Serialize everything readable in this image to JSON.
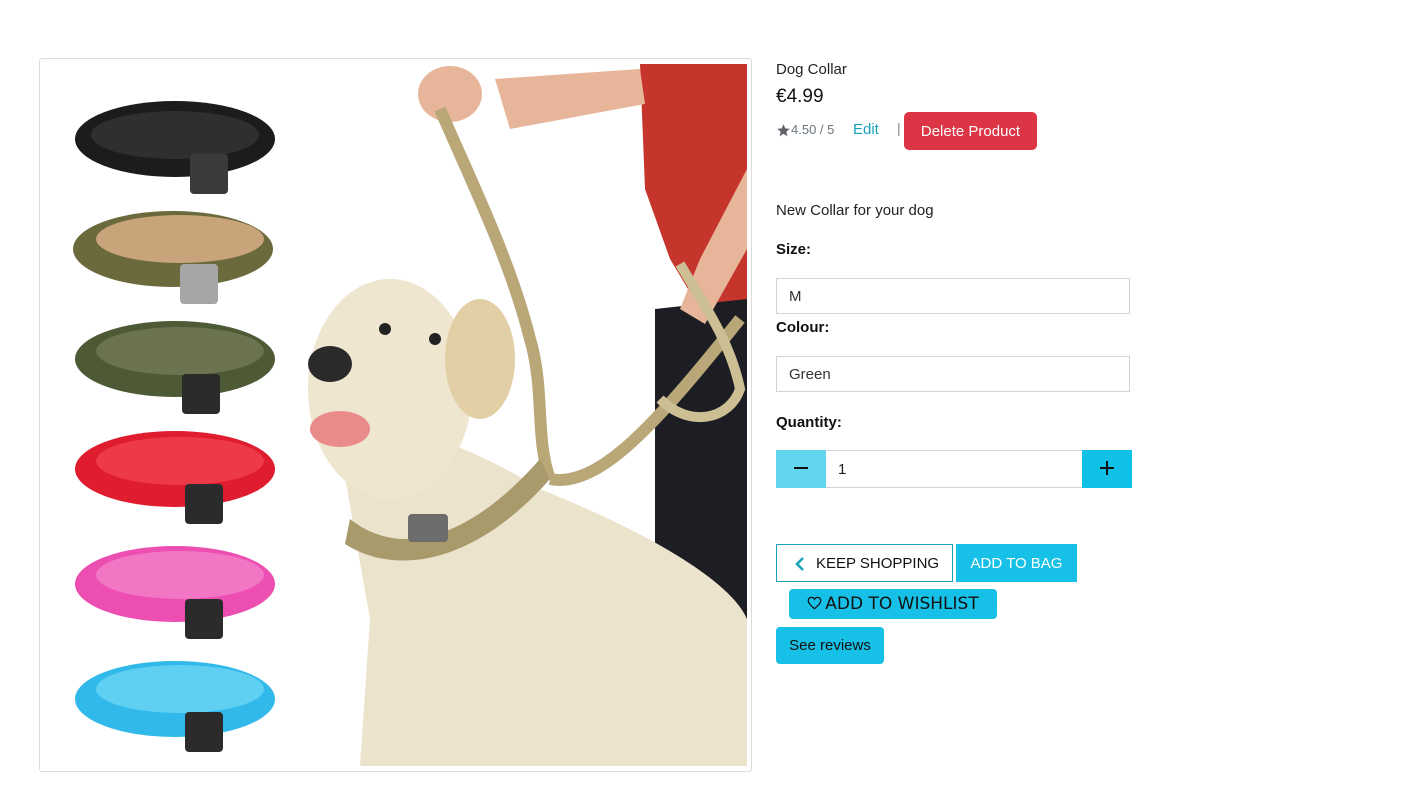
{
  "product": {
    "title": "Dog Collar",
    "price": "€4.99",
    "rating": "4.50 / 5",
    "description": "New Collar for your dog",
    "image_alt": "dog-collar-product-image"
  },
  "admin": {
    "edit_label": "Edit",
    "separator": "|",
    "delete_label": "Delete Product"
  },
  "options": {
    "size_label": "Size:",
    "size_value": "M",
    "colour_label": "Colour:",
    "colour_value": "Green",
    "quantity_label": "Quantity:",
    "quantity_value": "1"
  },
  "actions": {
    "keep_shopping": "KEEP SHOPPING",
    "add_to_bag": "ADD TO BAG",
    "add_to_wishlist": "ADD TO WISHLIST",
    "see_reviews": "See reviews"
  },
  "icons": {
    "rating": "star-icon",
    "decrement": "minus-icon",
    "increment": "plus-icon",
    "back": "chevron-left-icon",
    "wishlist": "heart-icon"
  },
  "colors": {
    "accent": "#17c0e6",
    "link": "#17a2b8",
    "danger": "#dc3545",
    "decrement_bg": "#62d6ee"
  }
}
